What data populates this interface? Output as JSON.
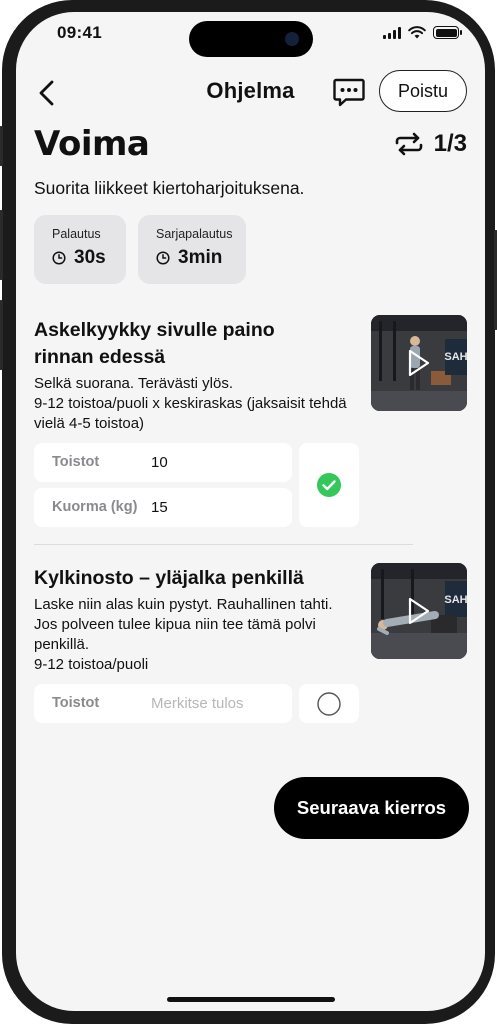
{
  "status_bar": {
    "time": "09:41"
  },
  "nav": {
    "title": "Ohjelma",
    "exit_label": "Poistu"
  },
  "workout": {
    "title": "Voima",
    "round": "1/3",
    "instruction": "Suorita liikkeet kiertoharjoituksena."
  },
  "rest": {
    "recovery_label": "Palautus",
    "recovery_value": "30s",
    "set_recovery_label": "Sarjapalautus",
    "set_recovery_value": "3min"
  },
  "exercises": [
    {
      "title": "Askelkyykky sivulle paino rinnan edessä",
      "description_lines": [
        "Selkä suorana. Terävästi ylös.",
        "9-12 toistoa/puoli x keskiraskas (jaksaisit tehdä",
        "vielä 4-5 toistoa)"
      ],
      "reps_label": "Toistot",
      "reps_value": "10",
      "load_label": "Kuorma (kg)",
      "load_value": "15",
      "completed": true,
      "thumbnail_badge": "SAH"
    },
    {
      "title": "Kylkinosto – yläjalka penkillä",
      "description_lines": [
        "Laske niin alas kuin pystyt. Rauhallinen tahti.",
        "Jos polveen tulee kipua niin tee tämä polvi",
        "penkillä.",
        "9-12 toistoa/puoli"
      ],
      "reps_label": "Toistot",
      "reps_placeholder": "Merkitse tulos",
      "completed": false,
      "thumbnail_badge": "SAH"
    }
  ],
  "footer": {
    "next_round_label": "Seuraava kierros"
  },
  "colors": {
    "accent_green": "#34c759",
    "background": "#f5f5f6",
    "primary_button": "#000000"
  },
  "icons": {
    "back": "chevron-left-icon",
    "chat": "chat-bubble-icon",
    "rounds": "repeat-icon",
    "timer": "clock-icon",
    "done": "check-circle-icon",
    "pending": "empty-circle-icon",
    "play": "play-icon"
  }
}
